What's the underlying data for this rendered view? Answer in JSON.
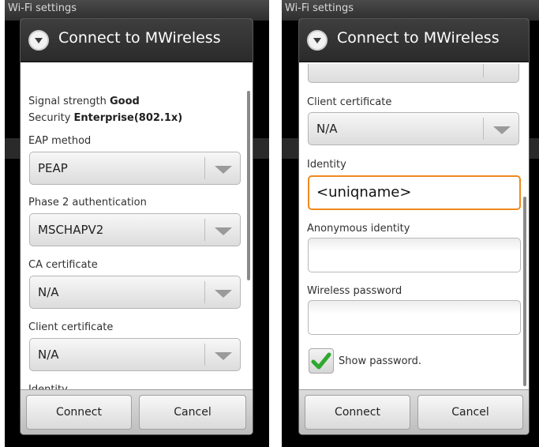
{
  "background": {
    "screen_title": "Wi-Fi settings"
  },
  "colors": {
    "focus_border": "#ef8a1f",
    "checkmark": "#2ea82e",
    "title_bar": "#333333"
  },
  "left_dialog": {
    "icon": "wifi-dropdown-circle-icon",
    "title": "Connect to MWireless",
    "signal_label": "Signal strength",
    "signal_value": "Good",
    "security_label": "Security",
    "security_value": "Enterprise(802.1x)",
    "eap_method": {
      "label": "EAP method",
      "value": "PEAP"
    },
    "phase2": {
      "label": "Phase 2 authentication",
      "value": "MSCHAPV2"
    },
    "ca_cert": {
      "label": "CA certificate",
      "value": "N/A"
    },
    "client_cert": {
      "label": "Client certificate",
      "value": "N/A"
    },
    "identity_label": "Identity",
    "connect": "Connect",
    "cancel": "Cancel"
  },
  "right_dialog": {
    "icon": "wifi-dropdown-circle-icon",
    "title": "Connect to MWireless",
    "client_cert": {
      "label": "Client certificate",
      "value": "N/A"
    },
    "identity": {
      "label": "Identity",
      "value": "<uniqname>"
    },
    "anonymous_identity": {
      "label": "Anonymous identity",
      "value": ""
    },
    "wireless_password": {
      "label": "Wireless password",
      "value": ""
    },
    "show_password": {
      "label": "Show password.",
      "checked": true
    },
    "connect": "Connect",
    "cancel": "Cancel"
  }
}
